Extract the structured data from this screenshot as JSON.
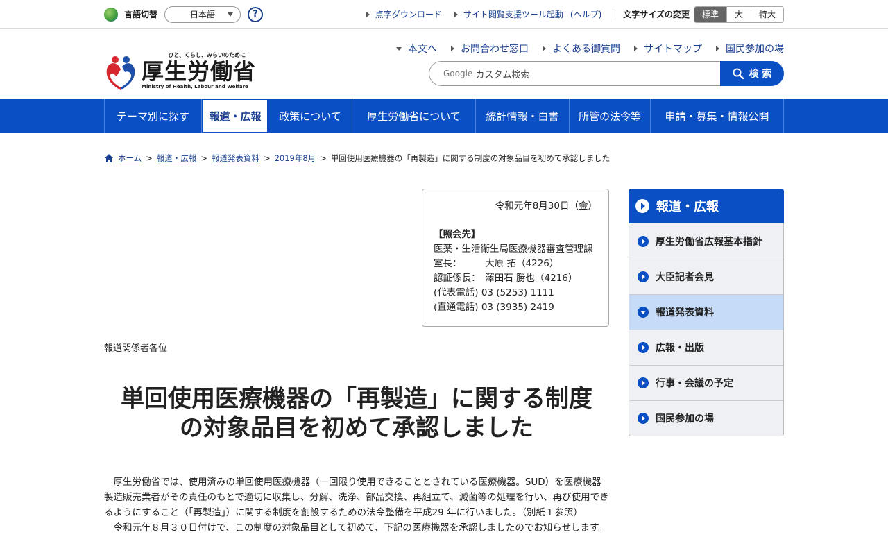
{
  "topbar": {
    "lang_label": "言語切替",
    "lang_value": "日本語",
    "help": "?",
    "links": [
      "点字ダウンロード",
      "サイト閲覧支援ツール起動",
      "(ヘルプ)"
    ],
    "size_label": "文字サイズの変更",
    "sizes": [
      "標準",
      "大",
      "特大"
    ]
  },
  "header": {
    "tagline": "ひと、くらし、みらいのために",
    "name": "厚生労働省",
    "english": "Ministry of Health, Labour and Welfare",
    "links": [
      "本文へ",
      "お問合わせ窓口",
      "よくある御質問",
      "サイトマップ",
      "国民参加の場"
    ],
    "search_google": "Google",
    "search_placeholder": "カスタム検索",
    "search_button": "検 索"
  },
  "gnav": [
    "テーマ別に探す",
    "報道・広報",
    "政策について",
    "厚生労働省について",
    "統計情報・白書",
    "所管の法令等",
    "申請・募集・情報公開"
  ],
  "breadcrumb": [
    "ホーム",
    "報道・広報",
    "報道発表資料",
    "2019年8月",
    "単回使用医療機器の「再製造」に関する制度の対象品目を初めて承認しました"
  ],
  "contact": {
    "date": "令和元年8月30日（金）",
    "head": "【照会先】",
    "lines": [
      "医薬・生活衛生局医療機器審査管理課",
      "室長：　　　大原 拓（4226）",
      "認証係長：　澤田石 勝也（4216）",
      "(代表電話) 03 (5253) 1111",
      "(直通電話) 03 (3935) 2419"
    ]
  },
  "addressee": "報道関係者各位",
  "title_line1": "単回使用医療機器の「再製造」に関する制度",
  "title_line2": "の対象品目を初めて承認しました",
  "body": [
    "厚生労働省では、使用済みの単回使用医療機器（一回限り使用できることとされている医療機器。SUD）を医療機器製造販売業者がその責任のもとで適切に収集し、分解、洗浄、部品交換、再組立て、滅菌等の処理を行い、再び使用できるようにすること（「再製造」）に関する制度を創設するための法令整備を平成29 年に行いました。（別紙１参照）",
    "令和元年８月３０日付けで、この制度の対象品目として初めて、下記の医療機器を承認しましたのでお知らせします。"
  ],
  "sidebar": {
    "head": "報道・広報",
    "items": [
      "厚生労働省広報基本指針",
      "大臣記者会見",
      "報道発表資料",
      "広報・出版",
      "行事・会議の予定",
      "国民参加の場"
    ]
  },
  "colors": {
    "brand_blue": "#0a4fc4",
    "active_side": "#c5dbf7"
  }
}
